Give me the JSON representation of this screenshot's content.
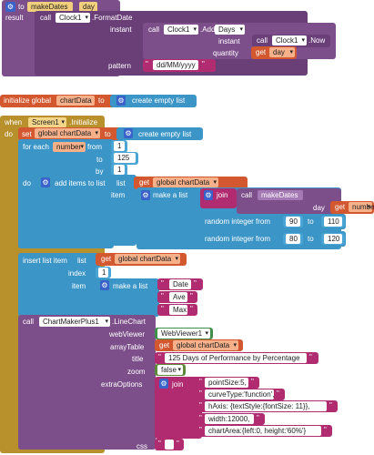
{
  "proc": {
    "to_kw": "to",
    "name": "makeDates",
    "param": "day",
    "result_kw": "result",
    "call_kw": "call",
    "component": "Clock1",
    "method_format": ".FormatDate",
    "instant_kw": "instant",
    "method_add_days": ".Add",
    "days_kw": "Days",
    "method_now": ".Now",
    "quantity_kw": "quantity",
    "get_kw": "get",
    "get_var": "day",
    "pattern_kw": "pattern",
    "pattern_value": "dd/MM/yyyy"
  },
  "global_init": {
    "label": "initialize global",
    "name": "chartData",
    "to_kw": "to",
    "create_list": "create empty list"
  },
  "event": {
    "when_kw": "when",
    "component": "Screen1",
    "event_name": ".Initialize",
    "do_kw": "do",
    "set_kw": "set",
    "set_var": "global chartData",
    "to_kw": "to",
    "create_list": "create empty list",
    "for_each": "for each",
    "loop_var": "number",
    "from_kw": "from",
    "from_val": "1",
    "to_val": "125",
    "by_kw": "by",
    "by_val": "1",
    "do2_kw": "do",
    "add_items": "add items to list",
    "list_kw": "list",
    "get_kw": "get",
    "get_global": "global chartData",
    "item_kw": "item",
    "make_list": "make a list",
    "join_kw": "join",
    "call_kw": "call",
    "call_proc": "makeDates",
    "day_kw": "day",
    "get_number": "number",
    "rand_label": "random integer from",
    "rand1_from": "90",
    "rand1_to": "110",
    "rand2_from": "80",
    "rand2_to": "120",
    "rand_to_kw": "to",
    "insert_label": "insert list item",
    "index_kw": "index",
    "index_val": "1",
    "header_date": "Date",
    "header_ave": "Ave",
    "header_max": "Max",
    "chart_call_kw": "call",
    "chart_component": "ChartMakerPlus1",
    "chart_method": ".LineChart",
    "webviewer_kw": "webViewer",
    "webviewer_val": "WebViewer1",
    "arraytable_kw": "arrayTable",
    "title_kw": "title",
    "title_val": "125 Days of Performance by Percentage",
    "zoom_kw": "zoom",
    "zoom_val": "false",
    "extra_kw": "extraOptions",
    "opt1": "pointSize:5,",
    "opt2": "curveType:'function',",
    "opt3": "hAxis: {textStyle:{fontSize: 11}},",
    "opt4": "width:12000,",
    "opt5": "chartArea:{left:0, height:'60%'}",
    "css_kw": "css",
    "css_val": ""
  },
  "colors": {
    "procedure": "#7c4e8a",
    "variable": "#d3572f",
    "list": "#3b95c7",
    "event": "#b8902c",
    "text": "#b12b71",
    "math": "#3b95c7",
    "component": "#3f8f4a"
  }
}
